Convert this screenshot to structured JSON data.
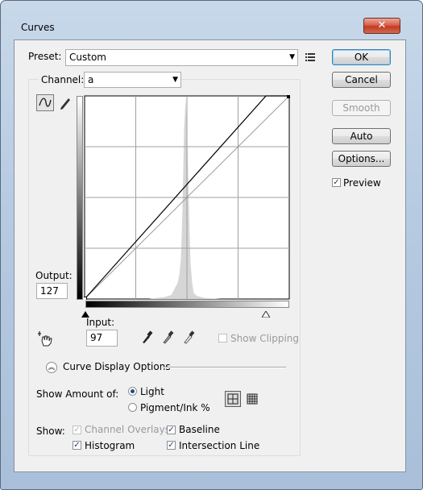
{
  "window": {
    "title": "Curves",
    "close_glyph": "✕"
  },
  "preset": {
    "label": "Preset:",
    "value": "Custom",
    "menu_icon": "preset-options-icon"
  },
  "channel": {
    "label": "Channel:",
    "value": "a"
  },
  "buttons": {
    "ok": "OK",
    "cancel": "Cancel",
    "smooth": "Smooth",
    "auto": "Auto",
    "options": "Options..."
  },
  "preview": {
    "label": "Preview",
    "checked": true
  },
  "output": {
    "label": "Output:",
    "value": "127"
  },
  "input": {
    "label": "Input:",
    "value": "97"
  },
  "show_clipping": {
    "label": "Show Clipping",
    "checked": false,
    "enabled": false
  },
  "curve_display_options": {
    "label": "Curve Display Options"
  },
  "show_amount": {
    "label": "Show Amount of:",
    "options": [
      "Light",
      "Pigment/Ink %"
    ],
    "selected": "Light"
  },
  "show": {
    "label": "Show:",
    "channel_overlays": {
      "label": "Channel Overlays",
      "checked": true,
      "enabled": false
    },
    "baseline": {
      "label": "Baseline",
      "checked": true
    },
    "histogram": {
      "label": "Histogram",
      "checked": true
    },
    "intersection_line": {
      "label": "Intersection Line",
      "checked": true
    }
  },
  "chart_data": {
    "type": "line",
    "title": "",
    "xlabel": "Input",
    "ylabel": "Output",
    "xlim": [
      0,
      255
    ],
    "ylim": [
      0,
      255
    ],
    "grid": "4x4",
    "series": [
      {
        "values": [
          [
            0,
            0
          ],
          [
            226,
            255
          ],
          [
            255,
            255
          ]
        ]
      },
      {
        "values": [
          [
            0,
            0
          ],
          [
            255,
            255
          ]
        ]
      }
    ],
    "histogram": {
      "bins_x": [
        0,
        80,
        100,
        108,
        112,
        116,
        118,
        120,
        122,
        124,
        126,
        128,
        130,
        132,
        134,
        136,
        140,
        150,
        170,
        255
      ],
      "heights": [
        0,
        0,
        0.01,
        0.02,
        0.05,
        0.08,
        0.12,
        0.2,
        0.45,
        0.85,
        1.0,
        0.8,
        0.45,
        0.18,
        0.08,
        0.03,
        0.015,
        0.005,
        0,
        0
      ]
    },
    "selected_point": [
      0,
      0
    ]
  }
}
